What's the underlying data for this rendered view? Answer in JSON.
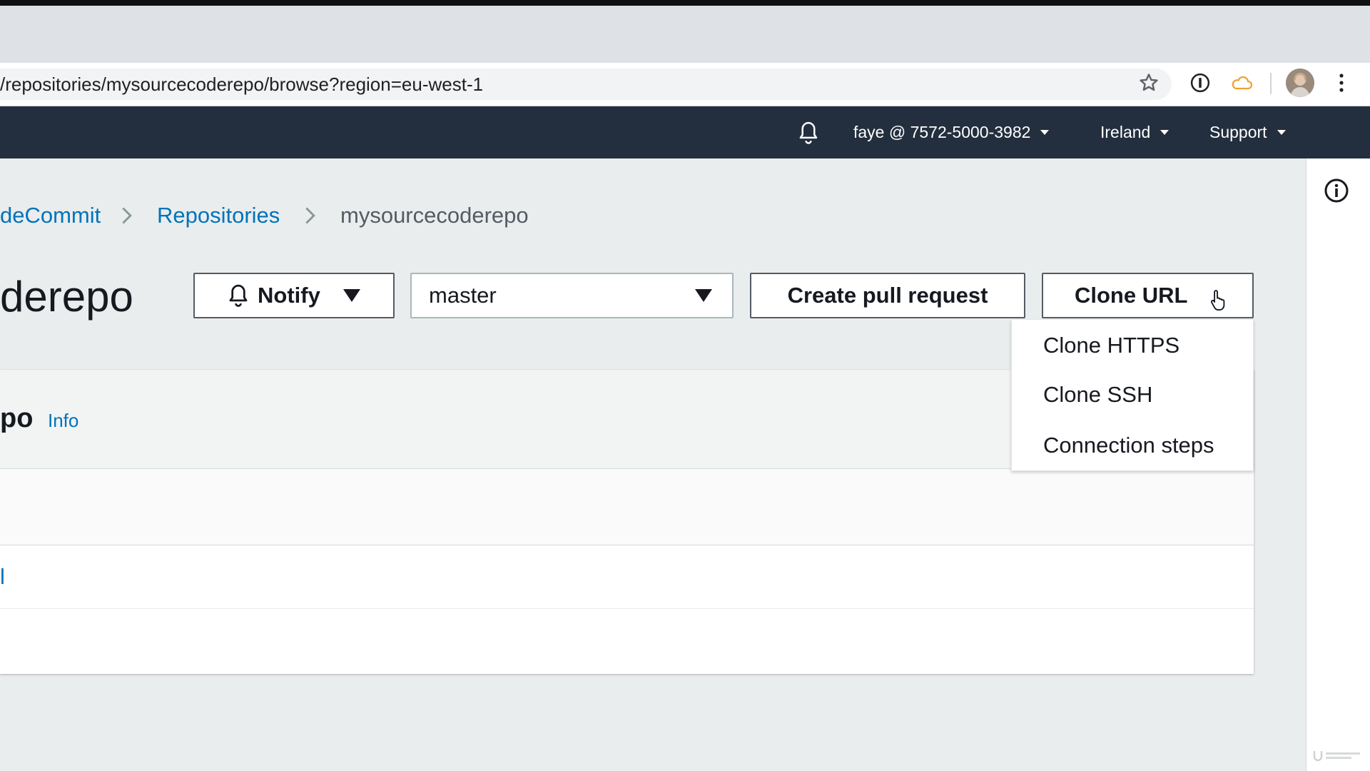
{
  "browser": {
    "url": "/repositories/mysourcecoderepo/browse?region=eu-west-1"
  },
  "nav": {
    "account": "faye @ 7572-5000-3982",
    "region": "Ireland",
    "support": "Support"
  },
  "breadcrumb": {
    "items": [
      "deCommit",
      "Repositories"
    ],
    "current": "mysourcecoderepo"
  },
  "page": {
    "title": "derepo"
  },
  "toolbar": {
    "notify_label": "Notify",
    "branch_value": "master",
    "create_pr_label": "Create pull request",
    "clone_url_label": "Clone URL"
  },
  "clone_menu": {
    "items": [
      "Clone HTTPS",
      "Clone SSH",
      "Connection steps"
    ]
  },
  "panel": {
    "title": "po",
    "info_link": "Info",
    "row1_link": "l"
  },
  "colors": {
    "aws_nav": "#232f3e",
    "link": "#0073bb",
    "background": "#eaeded"
  },
  "icons": [
    "star-icon",
    "password-icon",
    "cloud-icon",
    "kebab-icon",
    "bell-icon",
    "info-icon",
    "chevron-right-icon",
    "cursor-icon"
  ]
}
